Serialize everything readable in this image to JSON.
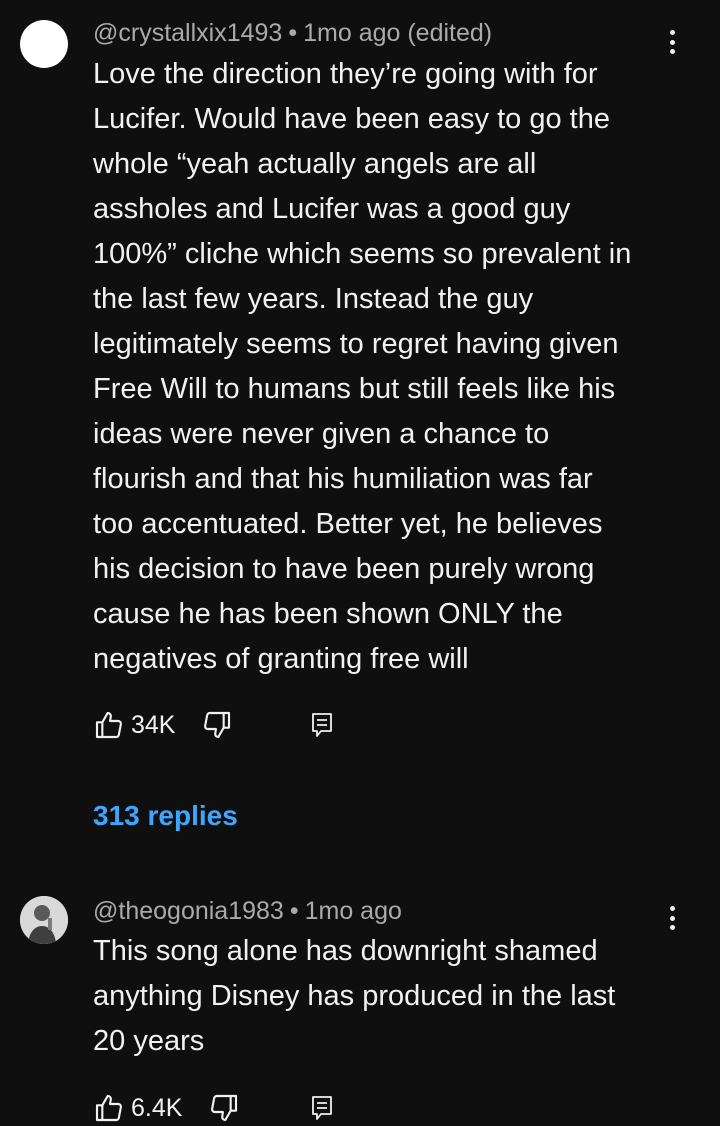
{
  "comments": [
    {
      "author": "@crystallxix1493",
      "time": "1mo ago (edited)",
      "text": "Love the direction they’re going with for\nLucifer. Would have been easy to go the\nwhole “yeah actually angels are all\nassholes and Lucifer was a good guy\n100%” cliche which seems so prevalent in\nthe last few years. Instead the guy\nlegitimately seems to regret  having given\nFree Will to humans but still feels like his\nideas were never given a chance to\nflourish and that his humiliation was far\ntoo accentuated. Better yet, he believes\nhis decision to have been purely wrong\ncause he has been shown ONLY the\nnegatives of granting free will",
      "likes": "34K",
      "replies": "313 replies"
    },
    {
      "author": "@theogonia1983",
      "time": "1mo ago",
      "text": "This song alone has downright shamed\nanything Disney has produced in the last\n20 years",
      "likes": "6.4K"
    }
  ],
  "separator": "•",
  "icons": {
    "like": "thumbs-up-icon",
    "dislike": "thumbs-down-icon",
    "reply": "reply-icon",
    "menu": "more-vertical-icon"
  },
  "colors": {
    "background": "#0f0f0f",
    "text": "#f1f1f1",
    "meta": "#aaaaaa",
    "link": "#3ea6ff"
  }
}
